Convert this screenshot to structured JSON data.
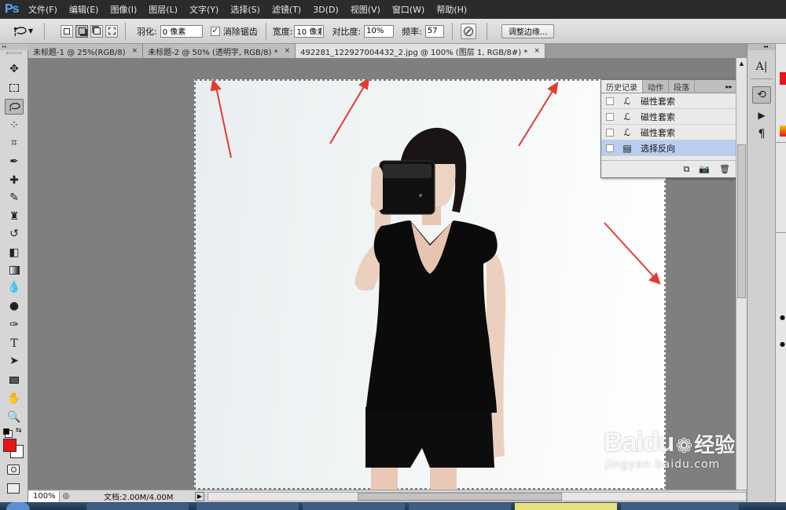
{
  "app": {
    "logo": "Ps"
  },
  "menu": [
    "文件(F)",
    "编辑(E)",
    "图像(I)",
    "图层(L)",
    "文字(Y)",
    "选择(S)",
    "滤镜(T)",
    "3D(D)",
    "视图(V)",
    "窗口(W)",
    "帮助(H)"
  ],
  "options": {
    "feather_label": "羽化:",
    "feather_value": "0 像素",
    "antialias_label": "消除锯齿",
    "width_label": "宽度:",
    "width_value": "10 像素",
    "contrast_label": "对比度:",
    "contrast_value": "10%",
    "frequency_label": "频率:",
    "frequency_value": "57",
    "refine_edge_label": "调整边缘..."
  },
  "tabs": [
    {
      "label": "未标题-1 @ 25%(RGB/8)",
      "close": "×"
    },
    {
      "label": "未标题-2 @ 50% (透明字, RGB/8) *",
      "close": "×"
    },
    {
      "label": "492281_122927004432_2.jpg @ 100% (图层 1, RGB/8#) *",
      "close": "×"
    }
  ],
  "history_panel": {
    "tabs": [
      "历史记录",
      "动作",
      "段落"
    ],
    "items": [
      {
        "label": "磁性套索"
      },
      {
        "label": "磁性套索"
      },
      {
        "label": "磁性套索"
      },
      {
        "label": "选择反向"
      }
    ]
  },
  "status": {
    "zoom": "100%",
    "doc_info": "文档:2.00M/4.00M"
  },
  "watermark": {
    "brand": "Baidu",
    "jingyan": "经验",
    "url": "jingyan.baidu.com"
  },
  "colors": {
    "foreground": "#e8141b",
    "background": "#ffffff",
    "selection": "#b9cdf0",
    "arrow": "#e53935"
  },
  "icons": {
    "tools": [
      "move-icon",
      "marquee-icon",
      "magnetic-lasso-icon",
      "quick-selection-icon",
      "crop-icon",
      "eyedropper-icon",
      "healing-brush-icon",
      "brush-icon",
      "clone-stamp-icon",
      "history-brush-icon",
      "eraser-icon",
      "gradient-icon",
      "blur-icon",
      "dodge-icon",
      "pen-icon",
      "type-icon",
      "path-selection-icon",
      "rectangle-icon",
      "hand-icon",
      "zoom-icon"
    ]
  }
}
